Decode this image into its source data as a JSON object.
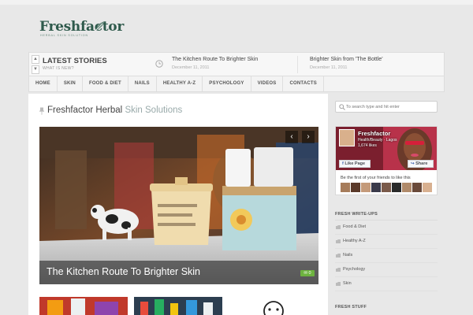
{
  "logo": {
    "word": "Freshfactor",
    "tagline": "HERBAL SKIN SOLUTION"
  },
  "latest": {
    "title": "LATEST STORIES",
    "subtitle": "WHAT IS NEW?",
    "stories": [
      {
        "title": "The Kitchen Route To Brighter Skin",
        "date": "December 11, 2011"
      },
      {
        "title": "Brighter Skin from 'The Bottle'",
        "date": "December 11, 2011"
      }
    ]
  },
  "nav": {
    "items": [
      "HOME",
      "SKIN",
      "FOOD & DIET",
      "NAILS",
      "HEALTHY A-Z",
      "PSYCHOLOGY",
      "VIDEOS",
      "CONTACTS"
    ]
  },
  "main": {
    "headline_dark": "Freshfactor Herbal",
    "headline_light": "Skin Solutions",
    "slide_caption": "The Kitchen Route To Brighter Skin",
    "comment_count": "0",
    "prev_glyph": "‹",
    "next_glyph": "›"
  },
  "sidebar": {
    "search_placeholder": "To search type and hit enter",
    "fb": {
      "page_name": "Freshfactor",
      "category": "Health/Beauty · Lagos",
      "likes": "1,674 likes",
      "like_label": "Like Page",
      "share_label": "Share",
      "friends_text": "Be the first of your friends to like this"
    },
    "writeups_title": "FRESH WRITE-UPS",
    "categories": [
      "Food & Diet",
      "Healthy A-Z",
      "Nails",
      "Psychology",
      "Skin"
    ],
    "stuff_title": "FRESH STUFF"
  },
  "colors": {
    "brand": "#2f5a4c",
    "accent": "#6db33f",
    "fb_blue": "#4267b2"
  }
}
